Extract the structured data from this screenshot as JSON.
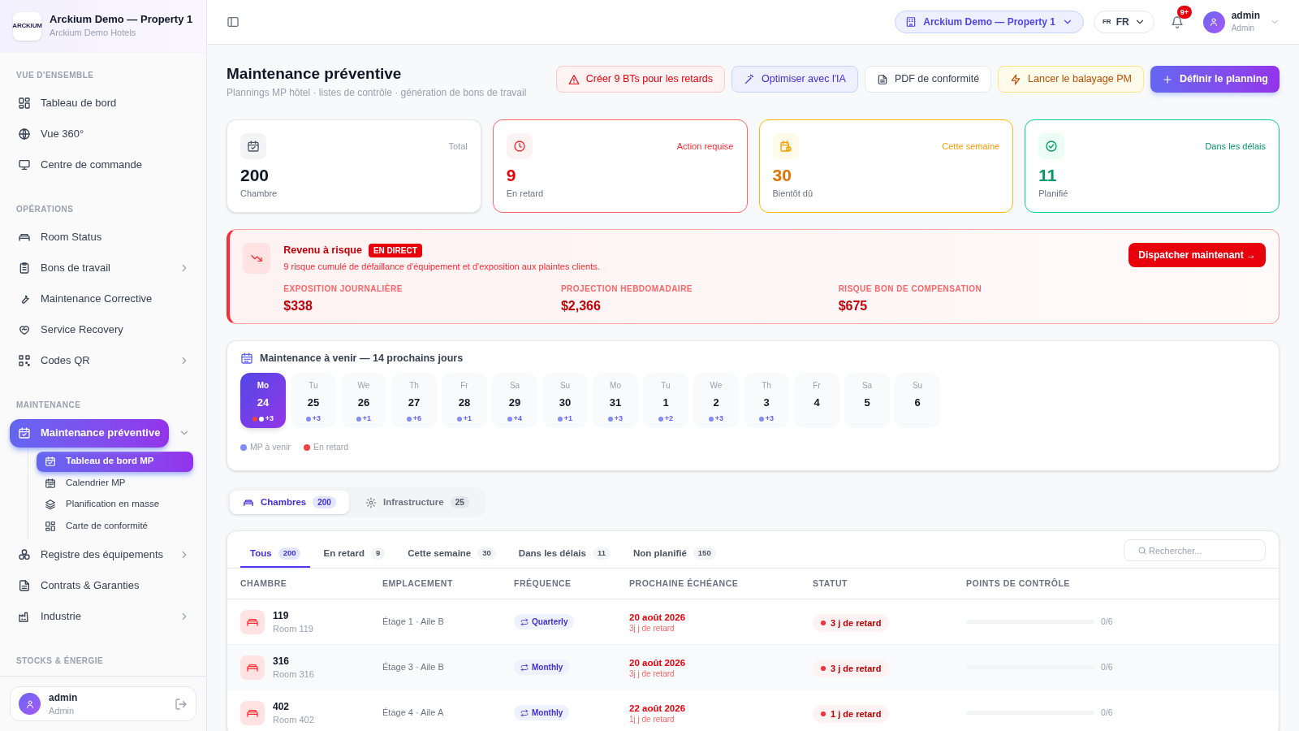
{
  "sidebar": {
    "brand": {
      "logo": "ARCKIUM",
      "title": "Arckium Demo — Property 1",
      "subtitle": "Arckium Demo Hotels"
    },
    "sections": [
      {
        "title": "VUE D'ENSEMBLE",
        "items": [
          {
            "label": "Tableau de bord",
            "selected": false
          },
          {
            "label": "Vue 360°",
            "selected": false
          },
          {
            "label": "Centre de commande",
            "selected": false
          }
        ]
      },
      {
        "title": "OPÉRATIONS",
        "items": [
          {
            "label": "Room Status",
            "selected": false
          },
          {
            "label": "Bons de travail",
            "selected": false,
            "expanded": false
          },
          {
            "label": "Maintenance Corrective",
            "selected": false
          },
          {
            "label": "Service Recovery",
            "selected": false
          },
          {
            "label": "Codes QR",
            "selected": false,
            "expanded": false
          }
        ]
      },
      {
        "title": "MAINTENANCE",
        "items": [
          {
            "label": "Maintenance préventive",
            "selected": true,
            "expanded": true,
            "children": [
              {
                "label": "Tableau de bord MP",
                "selected": true
              },
              {
                "label": "Calendrier MP",
                "selected": false
              },
              {
                "label": "Planification en masse",
                "selected": false
              },
              {
                "label": "Carte de conformité",
                "selected": false
              }
            ]
          },
          {
            "label": "Registre des équipements",
            "selected": false,
            "expanded": false
          },
          {
            "label": "Contrats & Garanties",
            "selected": false
          },
          {
            "label": "Industrie",
            "selected": false,
            "expanded": false
          }
        ]
      },
      {
        "title": "STOCKS & ÉNERGIE"
      }
    ],
    "user": {
      "name": "admin",
      "role": "Admin"
    }
  },
  "topbar": {
    "property": "Arckium Demo — Property 1",
    "language_code": "FR",
    "language": "FR",
    "notifications": "9+",
    "user": {
      "name": "admin",
      "role": "Admin"
    }
  },
  "header": {
    "title": "Maintenance préventive",
    "subtitle": "Plannings MP hôtel · listes de contrôle · génération de bons de travail",
    "actions": [
      {
        "label": "Créer 9 BTs pour les retards",
        "kind": "danger"
      },
      {
        "label": "Optimiser avec l'IA",
        "kind": "ai"
      },
      {
        "label": "PDF de conformité",
        "kind": "neutral"
      },
      {
        "label": "Lancer le balayage PM",
        "kind": "warning"
      },
      {
        "label": "Définir le planning",
        "kind": "primary"
      }
    ]
  },
  "stats": [
    {
      "kind": "neutral",
      "tag": "Total",
      "value": "200",
      "label": "Chambre"
    },
    {
      "kind": "danger",
      "tag": "Action requise",
      "value": "9",
      "label": "En retard"
    },
    {
      "kind": "warning",
      "tag": "Cette semaine",
      "value": "30",
      "label": "Bientôt dû"
    },
    {
      "kind": "success",
      "tag": "Dans les délais",
      "value": "11",
      "label": "Planifié"
    }
  ],
  "risk": {
    "title": "Revenu à risque",
    "badge": "EN DIRECT",
    "description": "9 risque cumulé de défaillance d'équipement et d'exposition aux plaintes clients.",
    "action": "Dispatcher maintenant →",
    "metrics": [
      {
        "label": "EXPOSITION JOURNALIÈRE",
        "value": "$338"
      },
      {
        "label": "PROJECTION HEBDOMADAIRE",
        "value": "$2,366"
      },
      {
        "label": "RISQUE BON DE COMPENSATION",
        "value": "$675"
      }
    ]
  },
  "calendar": {
    "title": "Maintenance à venir — 14 prochains jours",
    "days": [
      {
        "weekday": "Mo",
        "day": "24",
        "count": "+3",
        "overdue": true,
        "selected": true
      },
      {
        "weekday": "Tu",
        "day": "25",
        "count": "+3",
        "overdue": false,
        "selected": false
      },
      {
        "weekday": "We",
        "day": "26",
        "count": "+1",
        "overdue": false,
        "selected": false
      },
      {
        "weekday": "Th",
        "day": "27",
        "count": "+6",
        "overdue": false,
        "selected": false
      },
      {
        "weekday": "Fr",
        "day": "28",
        "count": "+1",
        "overdue": false,
        "selected": false
      },
      {
        "weekday": "Sa",
        "day": "29",
        "count": "+4",
        "overdue": false,
        "selected": false
      },
      {
        "weekday": "Su",
        "day": "30",
        "count": "+1",
        "overdue": false,
        "selected": false
      },
      {
        "weekday": "Mo",
        "day": "31",
        "count": "+3",
        "overdue": false,
        "selected": false
      },
      {
        "weekday": "Tu",
        "day": "1",
        "count": "+2",
        "overdue": false,
        "selected": false
      },
      {
        "weekday": "We",
        "day": "2",
        "count": "+3",
        "overdue": false,
        "selected": false
      },
      {
        "weekday": "Th",
        "day": "3",
        "count": "+3",
        "overdue": false,
        "selected": false
      },
      {
        "weekday": "Fr",
        "day": "4",
        "overdue": false,
        "selected": false
      },
      {
        "weekday": "Sa",
        "day": "5",
        "overdue": false,
        "selected": false
      },
      {
        "weekday": "Su",
        "day": "6",
        "overdue": false,
        "selected": false
      }
    ],
    "legend": [
      {
        "label": "MP à venir",
        "color": "#818cf8"
      },
      {
        "label": "En retard",
        "color": "#ef4444"
      }
    ]
  },
  "category_tabs": [
    {
      "label": "Chambres",
      "count": "200",
      "selected": true
    },
    {
      "label": "Infrastructure",
      "count": "25",
      "selected": false
    }
  ],
  "filter_tabs": [
    {
      "label": "Tous",
      "count": "200",
      "selected": true
    },
    {
      "label": "En retard",
      "count": "9",
      "selected": false
    },
    {
      "label": "Cette semaine",
      "count": "30",
      "selected": false
    },
    {
      "label": "Dans les délais",
      "count": "11",
      "selected": false
    },
    {
      "label": "Non planifié",
      "count": "150",
      "selected": false
    }
  ],
  "search": {
    "placeholder": "Rechercher..."
  },
  "table": {
    "columns": [
      "CHAMBRE",
      "EMPLACEMENT",
      "FRÉQUENCE",
      "PROCHAINE ÉCHÉANCE",
      "STATUT",
      "POINTS DE CONTRÔLE"
    ],
    "rows": [
      {
        "room": "119",
        "room_sub": "Room 119",
        "location": "Étage 1 · Aile B",
        "frequency": "Quarterly",
        "due": "20 août 2026",
        "due_note": "3j j de retard",
        "status": "3 j de retard",
        "checkpoints": "0/6",
        "level": 0
      },
      {
        "room": "316",
        "room_sub": "Room 316",
        "location": "Étage 3 · Aile B",
        "frequency": "Monthly",
        "due": "20 août 2026",
        "due_note": "3j j de retard",
        "status": "3 j de retard",
        "checkpoints": "0/6",
        "level": 0
      },
      {
        "room": "402",
        "room_sub": "Room 402",
        "location": "Étage 4 · Aile A",
        "frequency": "Monthly",
        "due": "22 août 2026",
        "due_note": "1j j de retard",
        "status": "1 j de retard",
        "checkpoints": "0/6",
        "level": 0
      }
    ]
  }
}
